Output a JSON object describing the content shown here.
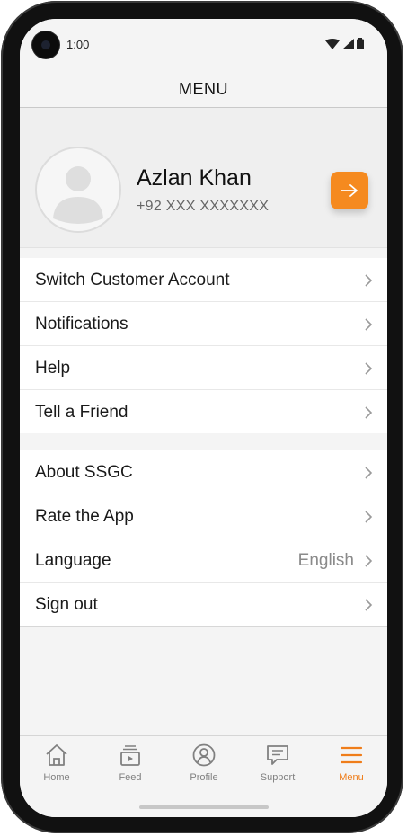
{
  "status_bar": {
    "time": "1:00"
  },
  "header": {
    "title": "MENU"
  },
  "profile": {
    "name": "Azlan Khan",
    "phone": "+92 XXX XXXXXXX"
  },
  "menu_group_1": [
    {
      "label": "Switch Customer Account"
    },
    {
      "label": "Notifications"
    },
    {
      "label": "Help"
    },
    {
      "label": "Tell a Friend"
    }
  ],
  "menu_group_2": [
    {
      "label": "About SSGC"
    },
    {
      "label": "Rate the App"
    },
    {
      "label": "Language",
      "value": "English"
    },
    {
      "label": "Sign out"
    }
  ],
  "bottom_nav": {
    "items": [
      {
        "label": "Home",
        "icon": "home-icon"
      },
      {
        "label": "Feed",
        "icon": "feed-icon"
      },
      {
        "label": "Profile",
        "icon": "profile-icon"
      },
      {
        "label": "Support",
        "icon": "support-icon"
      },
      {
        "label": "Menu",
        "icon": "menu-icon",
        "active": true
      }
    ]
  },
  "colors": {
    "accent": "#f58a1f",
    "active_nav": "#ef7d1a",
    "background": "#f4f4f4"
  }
}
